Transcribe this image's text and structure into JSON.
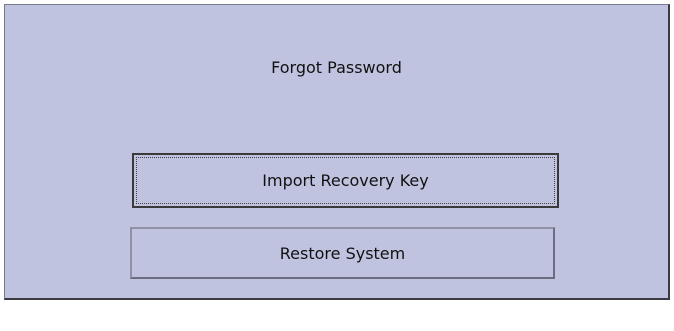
{
  "dialog": {
    "title": "Forgot Password",
    "buttons": {
      "import_recovery_key": "Import Recovery Key",
      "restore_system": "Restore System"
    }
  }
}
